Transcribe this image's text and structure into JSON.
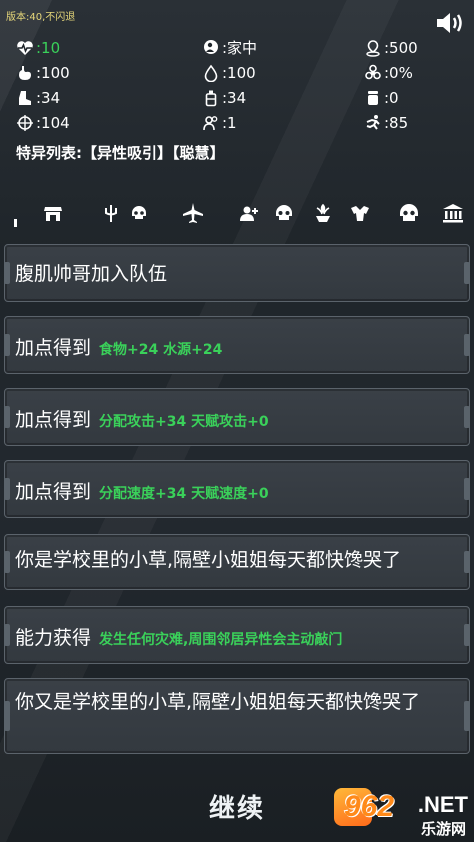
{
  "version": "版本:40,不闪退",
  "stats": [
    {
      "icon": "heart-rate-icon",
      "value": ":10",
      "color": "#3ad15a"
    },
    {
      "icon": "location-person-icon",
      "value": ":家中"
    },
    {
      "icon": "pin-icon",
      "value": ":500"
    },
    {
      "icon": "stomach-icon",
      "value": ":100"
    },
    {
      "icon": "water-drop-icon",
      "value": ":100"
    },
    {
      "icon": "biohazard-icon",
      "value": ":0%"
    },
    {
      "icon": "boot-icon",
      "value": ":34"
    },
    {
      "icon": "bottle-icon",
      "value": ":34"
    },
    {
      "icon": "jar-icon",
      "value": ":0"
    },
    {
      "icon": "crosshair-icon",
      "value": ":104"
    },
    {
      "icon": "people-icon",
      "value": ":1"
    },
    {
      "icon": "running-icon",
      "value": ":85"
    }
  ],
  "traits": "特异列表:【异性吸引】【聪慧】",
  "cards": [
    {
      "text": "腹肌帅哥加入队伍"
    },
    {
      "text": "加点得到",
      "green": "食物+24  水源+24"
    },
    {
      "text": "加点得到",
      "green": "分配攻击+34  天赋攻击+0"
    },
    {
      "text": "加点得到",
      "green": "分配速度+34  天赋速度+0"
    },
    {
      "text": "你是学校里的小草,隔壁小姐姐每天都快馋哭了"
    },
    {
      "text": "能力获得",
      "green": "发生任何灾难,周围邻居异性会主动敲门"
    },
    {
      "text": "你又是学校里的小草,隔壁小姐姐每天都快馋哭了"
    }
  ],
  "continue": "继续",
  "watermark": {
    "num": "962",
    "net": ".NET",
    "cn": "乐游网"
  }
}
